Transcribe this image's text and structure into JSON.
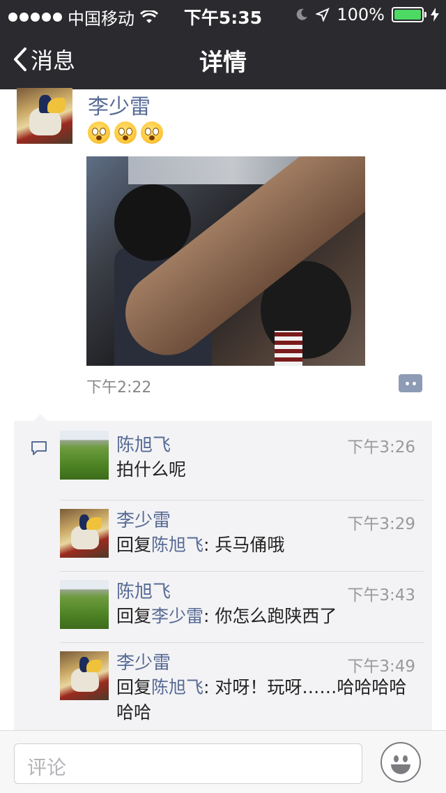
{
  "status_bar": {
    "carrier": "中国移动",
    "time": "下午5:35",
    "battery": "100%",
    "battery_color": "#4cd964"
  },
  "nav": {
    "back_label": "消息",
    "title": "详情"
  },
  "post": {
    "author": "李少雷",
    "emoji_icons": [
      "shocked-face-icon",
      "shocked-face-icon",
      "shocked-face-icon"
    ],
    "time": "下午2:22",
    "comment_button_icon": "comment-dots-icon"
  },
  "comments": [
    {
      "author": "陈旭飞",
      "time": "下午3:26",
      "text": "拍什么呢",
      "avatar": "grass-field"
    },
    {
      "author": "李少雷",
      "time": "下午3:29",
      "reply_prefix": "回复",
      "reply_to": "陈旭飞",
      "text": ": 兵马俑哦",
      "avatar": "napoleon"
    },
    {
      "author": "陈旭飞",
      "time": "下午3:43",
      "reply_prefix": "回复",
      "reply_to": "李少雷",
      "text": ": 你怎么跑陕西了",
      "avatar": "grass-field"
    },
    {
      "author": "李少雷",
      "time": "下午3:49",
      "reply_prefix": "回复",
      "reply_to": "陈旭飞",
      "text": ": 对呀！玩呀……哈哈哈哈哈哈",
      "avatar": "napoleon"
    }
  ],
  "input": {
    "placeholder": "评论",
    "emoji_button_icon": "smiley-face-icon"
  },
  "colors": {
    "nav_bg": "#2b2b2f",
    "link_blue": "#576b95",
    "comment_bg": "#f3f3f5"
  }
}
